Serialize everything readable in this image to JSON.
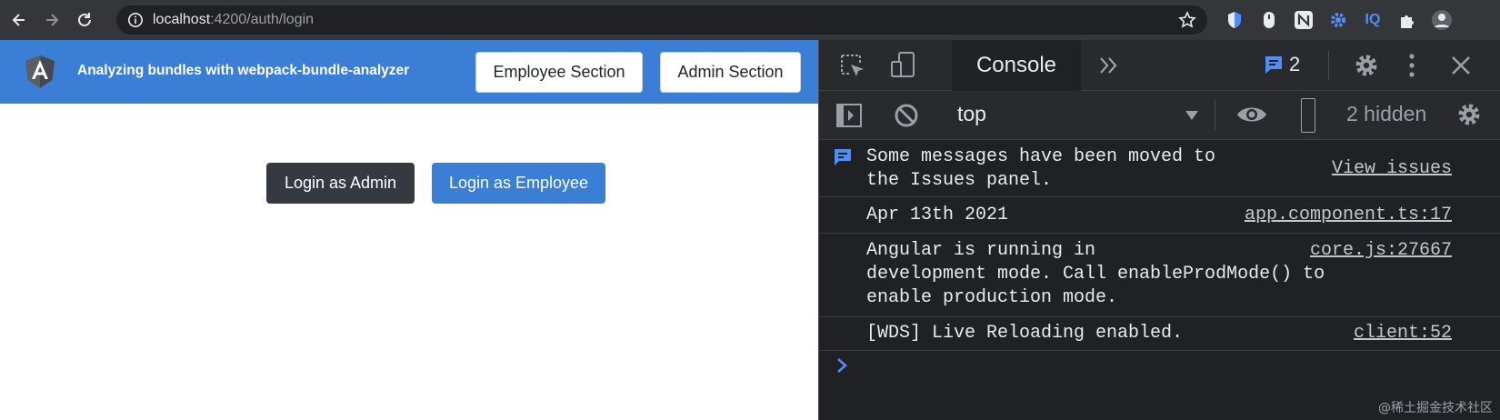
{
  "browser": {
    "url_host": "localhost",
    "url_rest": ":4200/auth/login",
    "extensions": [
      "shield-extension-icon",
      "mouse-extension-icon",
      "n-extension-icon",
      "gear-extension-icon",
      "iq-extension",
      "puzzle-icon",
      "avatar"
    ],
    "iq_label": "IQ"
  },
  "app": {
    "title": "Analyzing bundles with webpack-bundle-analyzer",
    "nav_buttons": [
      "Employee Section",
      "Admin Section"
    ],
    "login_admin_label": "Login as Admin",
    "login_employee_label": "Login as Employee",
    "colors": {
      "navbar": "#3a7fd5",
      "dark_button": "#343a40",
      "primary_button": "#3a7fd5"
    }
  },
  "devtools": {
    "active_tab": "Console",
    "issues_count": "2",
    "context": "top",
    "hidden_label": "2 hidden",
    "messages": [
      {
        "text": "Some messages have been moved to\nthe Issues panel.",
        "link": "View issues"
      },
      {
        "text": "Apr 13th 2021",
        "link": "app.component.ts:17"
      },
      {
        "text": "Angular is running in\ndevelopment mode. Call enableProdMode() to\nenable production mode.",
        "link": "core.js:27667"
      },
      {
        "text": "[WDS] Live Reloading enabled.",
        "link": "client:52"
      }
    ]
  },
  "watermark": "@稀土掘金技术社区"
}
